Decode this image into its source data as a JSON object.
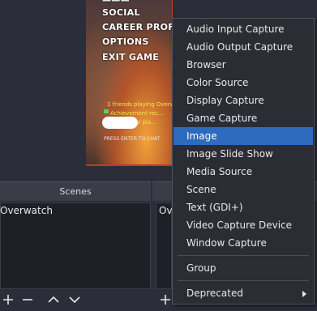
{
  "game_menu": [
    "SOCIAL",
    "CAREER PROFILE",
    "OPTIONS",
    "EXIT GAME"
  ],
  "game_chat": {
    "line1": "1 friends playing Overw...",
    "line2": "Achievement rec...",
    "line3": "skipped pla...",
    "press_enter": "PRESS ENTER TO CHAT"
  },
  "scenes": {
    "title": "Scenes",
    "items": [
      "Overwatch"
    ]
  },
  "sources": {
    "items": [
      "Ov"
    ]
  },
  "toolbar": {
    "add": "+",
    "remove": "−"
  },
  "context_menu": {
    "items": [
      "Audio Input Capture",
      "Audio Output Capture",
      "Browser",
      "Color Source",
      "Display Capture",
      "Game Capture",
      "Image",
      "Image Slide Show",
      "Media Source",
      "Scene",
      "Text (GDI+)",
      "Video Capture Device",
      "Window Capture"
    ],
    "selected": "Image",
    "group": "Group",
    "deprecated": "Deprecated"
  },
  "colors": {
    "highlight": "#2d6bbf",
    "menu_bg": "#2b2d35",
    "panel_bg": "#1e2028"
  }
}
